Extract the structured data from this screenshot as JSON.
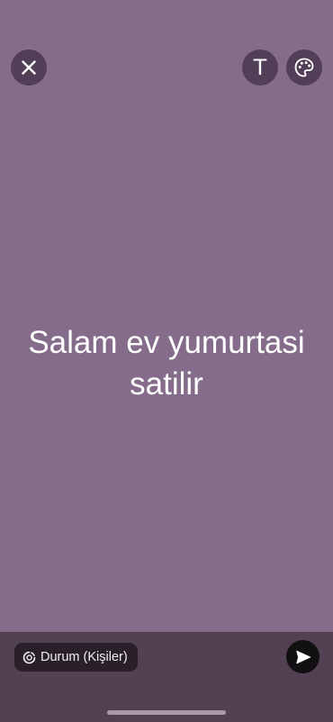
{
  "status_editor": {
    "background_color": "#856c8b",
    "status_text": "Salam ev yumurtasi\nsatilir",
    "toolbar": {
      "close_icon": "close-icon",
      "text_tool_label": "T",
      "palette_icon": "palette-icon"
    }
  },
  "bottom_bar": {
    "audience_label": "Durum (Kişiler)",
    "audience_icon": "status-ring-icon",
    "send_icon": "send-icon"
  }
}
